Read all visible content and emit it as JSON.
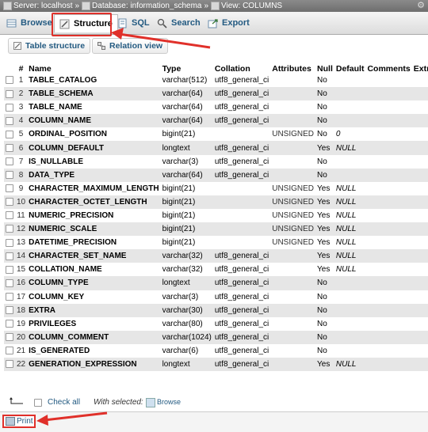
{
  "breadcrumb": {
    "server": "Server: localhost",
    "database": "Database: information_schema",
    "view": "View: COLUMNS",
    "separator": "»"
  },
  "tabs": [
    {
      "label": "Browse",
      "icon": "browse-icon"
    },
    {
      "label": "Structure",
      "icon": "structure-icon",
      "active": true
    },
    {
      "label": "SQL",
      "icon": "sql-icon"
    },
    {
      "label": "Search",
      "icon": "search-icon"
    },
    {
      "label": "Export",
      "icon": "export-icon"
    }
  ],
  "subtabs": [
    {
      "label": "Table structure",
      "icon": "table-structure-icon"
    },
    {
      "label": "Relation view",
      "icon": "relation-view-icon"
    }
  ],
  "table": {
    "headers": [
      "#",
      "Name",
      "Type",
      "Collation",
      "Attributes",
      "Null",
      "Default",
      "Comments",
      "Extra"
    ],
    "rows": [
      {
        "num": "1",
        "name": "TABLE_CATALOG",
        "type": "varchar(512)",
        "collation": "utf8_general_ci",
        "attributes": "",
        "null": "No",
        "default": ""
      },
      {
        "num": "2",
        "name": "TABLE_SCHEMA",
        "type": "varchar(64)",
        "collation": "utf8_general_ci",
        "attributes": "",
        "null": "No",
        "default": ""
      },
      {
        "num": "3",
        "name": "TABLE_NAME",
        "type": "varchar(64)",
        "collation": "utf8_general_ci",
        "attributes": "",
        "null": "No",
        "default": ""
      },
      {
        "num": "4",
        "name": "COLUMN_NAME",
        "type": "varchar(64)",
        "collation": "utf8_general_ci",
        "attributes": "",
        "null": "No",
        "default": ""
      },
      {
        "num": "5",
        "name": "ORDINAL_POSITION",
        "type": "bigint(21)",
        "collation": "",
        "attributes": "UNSIGNED",
        "null": "No",
        "default": "0"
      },
      {
        "num": "6",
        "name": "COLUMN_DEFAULT",
        "type": "longtext",
        "collation": "utf8_general_ci",
        "attributes": "",
        "null": "Yes",
        "default": "NULL"
      },
      {
        "num": "7",
        "name": "IS_NULLABLE",
        "type": "varchar(3)",
        "collation": "utf8_general_ci",
        "attributes": "",
        "null": "No",
        "default": ""
      },
      {
        "num": "8",
        "name": "DATA_TYPE",
        "type": "varchar(64)",
        "collation": "utf8_general_ci",
        "attributes": "",
        "null": "No",
        "default": ""
      },
      {
        "num": "9",
        "name": "CHARACTER_MAXIMUM_LENGTH",
        "type": "bigint(21)",
        "collation": "",
        "attributes": "UNSIGNED",
        "null": "Yes",
        "default": "NULL"
      },
      {
        "num": "10",
        "name": "CHARACTER_OCTET_LENGTH",
        "type": "bigint(21)",
        "collation": "",
        "attributes": "UNSIGNED",
        "null": "Yes",
        "default": "NULL"
      },
      {
        "num": "11",
        "name": "NUMERIC_PRECISION",
        "type": "bigint(21)",
        "collation": "",
        "attributes": "UNSIGNED",
        "null": "Yes",
        "default": "NULL"
      },
      {
        "num": "12",
        "name": "NUMERIC_SCALE",
        "type": "bigint(21)",
        "collation": "",
        "attributes": "UNSIGNED",
        "null": "Yes",
        "default": "NULL"
      },
      {
        "num": "13",
        "name": "DATETIME_PRECISION",
        "type": "bigint(21)",
        "collation": "",
        "attributes": "UNSIGNED",
        "null": "Yes",
        "default": "NULL"
      },
      {
        "num": "14",
        "name": "CHARACTER_SET_NAME",
        "type": "varchar(32)",
        "collation": "utf8_general_ci",
        "attributes": "",
        "null": "Yes",
        "default": "NULL"
      },
      {
        "num": "15",
        "name": "COLLATION_NAME",
        "type": "varchar(32)",
        "collation": "utf8_general_ci",
        "attributes": "",
        "null": "Yes",
        "default": "NULL"
      },
      {
        "num": "16",
        "name": "COLUMN_TYPE",
        "type": "longtext",
        "collation": "utf8_general_ci",
        "attributes": "",
        "null": "No",
        "default": ""
      },
      {
        "num": "17",
        "name": "COLUMN_KEY",
        "type": "varchar(3)",
        "collation": "utf8_general_ci",
        "attributes": "",
        "null": "No",
        "default": ""
      },
      {
        "num": "18",
        "name": "EXTRA",
        "type": "varchar(30)",
        "collation": "utf8_general_ci",
        "attributes": "",
        "null": "No",
        "default": ""
      },
      {
        "num": "19",
        "name": "PRIVILEGES",
        "type": "varchar(80)",
        "collation": "utf8_general_ci",
        "attributes": "",
        "null": "No",
        "default": ""
      },
      {
        "num": "20",
        "name": "COLUMN_COMMENT",
        "type": "varchar(1024)",
        "collation": "utf8_general_ci",
        "attributes": "",
        "null": "No",
        "default": ""
      },
      {
        "num": "21",
        "name": "IS_GENERATED",
        "type": "varchar(6)",
        "collation": "utf8_general_ci",
        "attributes": "",
        "null": "No",
        "default": ""
      },
      {
        "num": "22",
        "name": "GENERATION_EXPRESSION",
        "type": "longtext",
        "collation": "utf8_general_ci",
        "attributes": "",
        "null": "Yes",
        "default": "NULL"
      }
    ]
  },
  "footer": {
    "check_all": "Check all",
    "with_selected": "With selected:",
    "browse": "Browse"
  },
  "print": {
    "label": "Print"
  },
  "colors": {
    "highlight": "#e0302a",
    "link": "#235a81",
    "row_alt": "#e6e6e6"
  }
}
